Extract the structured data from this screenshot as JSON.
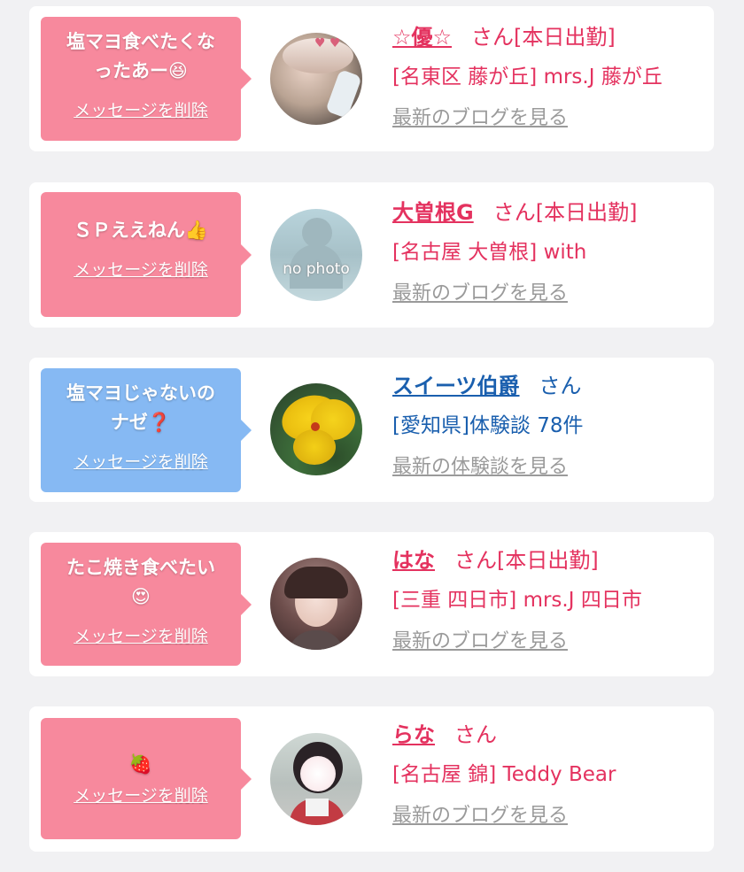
{
  "cards": [
    {
      "message_line1": "塩マヨ食べたくな",
      "message_line2": "ったあー😆",
      "delete_label": "メッセージを削除",
      "name": "☆優☆",
      "san": "さん",
      "status": "[本日出勤]",
      "detail": "[名東区 藤が丘] mrs.J 藤が丘",
      "link": "最新のブログを見る",
      "accent": "#e4325f",
      "bubble_color": "#f7899d"
    },
    {
      "message_line1": "ＳＰええねん👍",
      "delete_label": "メッセージを削除",
      "name": "大曽根G",
      "san": "さん",
      "status": "[本日出勤]",
      "detail": "[名古屋 大曽根] with",
      "link": "最新のブログを見る",
      "avatar_text": "no photo",
      "accent": "#e4325f",
      "bubble_color": "#f7899d"
    },
    {
      "message_line1": "塩マヨじゃないの",
      "message_line2": "ナゼ❓",
      "delete_label": "メッセージを削除",
      "name": "スイーツ伯爵",
      "san": "さん",
      "detail": "[愛知県]体験談 78件",
      "link": "最新の体験談を見る",
      "accent": "#1a5fae",
      "bubble_color": "#86b9f3"
    },
    {
      "message_line1": "たこ焼き食べたい",
      "message_line2": "😍",
      "delete_label": "メッセージを削除",
      "name": "はな",
      "san": "さん",
      "status": "[本日出勤]",
      "detail": "[三重 四日市] mrs.J 四日市",
      "link": "最新のブログを見る",
      "accent": "#e4325f",
      "bubble_color": "#f7899d"
    },
    {
      "message_line1": "🍓",
      "delete_label": "メッセージを削除",
      "name": "らな",
      "san": "さん",
      "detail": "[名古屋 錦] Teddy Bear",
      "link": "最新のブログを見る",
      "accent": "#e4325f",
      "bubble_color": "#f7899d"
    }
  ]
}
